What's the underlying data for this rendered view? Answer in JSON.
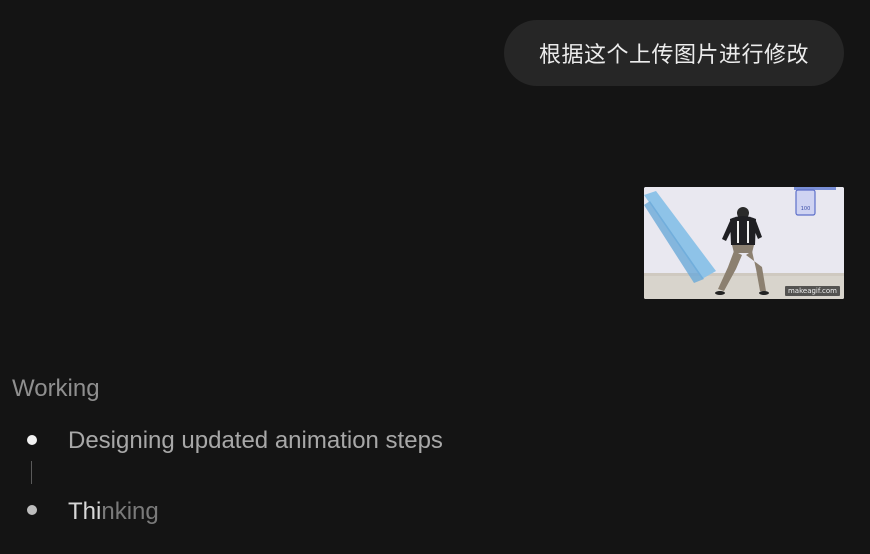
{
  "conversation": {
    "user_message": "根据这个上传图片进行修改",
    "attachment": {
      "kind": "image",
      "watermark": "makeagif.com",
      "sign_text": "100"
    }
  },
  "status": {
    "heading": "Working",
    "steps": [
      {
        "label": "Designing updated animation steps",
        "state": "done"
      },
      {
        "label_highlight": "Thi",
        "label_rest": "nking",
        "state": "in-progress"
      }
    ]
  },
  "colors": {
    "background": "#141414",
    "bubble": "#262626",
    "text_primary": "#ececec",
    "text_muted": "#8f8f8f"
  }
}
